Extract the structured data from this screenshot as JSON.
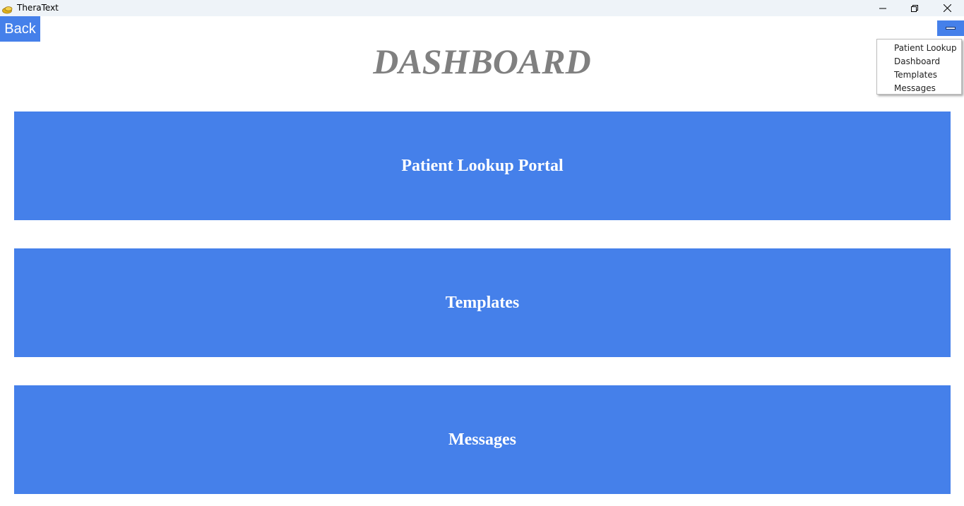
{
  "window": {
    "title": "TheraText",
    "icon": "app-logo-icon",
    "controls": [
      "minimize-icon",
      "restore-icon",
      "close-icon"
    ]
  },
  "header": {
    "back_label": "Back",
    "menu_icon": "menu-toggle-icon",
    "page_title": "DASHBOARD"
  },
  "dropdown": {
    "items": [
      {
        "label": "Patient Lookup"
      },
      {
        "label": "Dashboard"
      },
      {
        "label": "Templates"
      },
      {
        "label": "Messages"
      }
    ]
  },
  "cards": [
    {
      "label": "Patient Lookup Portal"
    },
    {
      "label": "Templates"
    },
    {
      "label": "Messages"
    }
  ],
  "colors": {
    "accent": "#4580ea",
    "title_text": "#808080",
    "titlebar": "#eef3f8"
  }
}
